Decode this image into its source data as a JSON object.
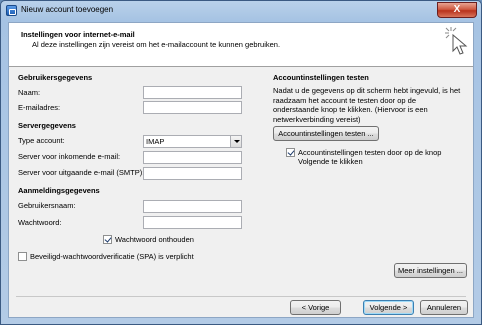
{
  "window": {
    "title": "Nieuw account toevoegen",
    "close_label": "X"
  },
  "header": {
    "title": "Instellingen voor internet-e-mail",
    "subtitle": "Al deze instellingen zijn vereist om het e-mailaccount te kunnen gebruiken."
  },
  "user_info": {
    "section": "Gebruikersgegevens",
    "name_label": "Naam:",
    "name_value": "",
    "email_label": "E-mailadres:",
    "email_value": ""
  },
  "server_info": {
    "section": "Servergegevens",
    "account_type_label": "Type account:",
    "account_type_value": "IMAP",
    "incoming_label": "Server voor inkomende e-mail:",
    "incoming_value": "",
    "outgoing_label": "Server voor uitgaande e-mail (SMTP):",
    "outgoing_value": ""
  },
  "login_info": {
    "section": "Aanmeldingsgegevens",
    "username_label": "Gebruikersnaam:",
    "username_value": "",
    "password_label": "Wachtwoord:",
    "password_value": "",
    "remember_password_label": "Wachtwoord onthouden",
    "spa_label": "Beveiligd-wachtwoordverificatie (SPA) is verplicht"
  },
  "test_settings": {
    "section": "Accountinstellingen testen",
    "description": "Nadat u de gegevens op dit scherm hebt ingevuld, is het raadzaam het account te testen door op de onderstaande knop te klikken. (Hiervoor is een netwerkverbinding vereist)",
    "test_button": "Accountinstellingen testen ...",
    "auto_test_label_1": "Accountinstellingen testen door op de knop",
    "auto_test_label_2": "Volgende te klikken"
  },
  "buttons": {
    "more_settings": "Meer instellingen ...",
    "back": "< Vorige",
    "next": "Volgende >",
    "cancel": "Annuleren"
  },
  "checkbox_states": {
    "remember_password": true,
    "spa": false,
    "auto_test": true
  }
}
